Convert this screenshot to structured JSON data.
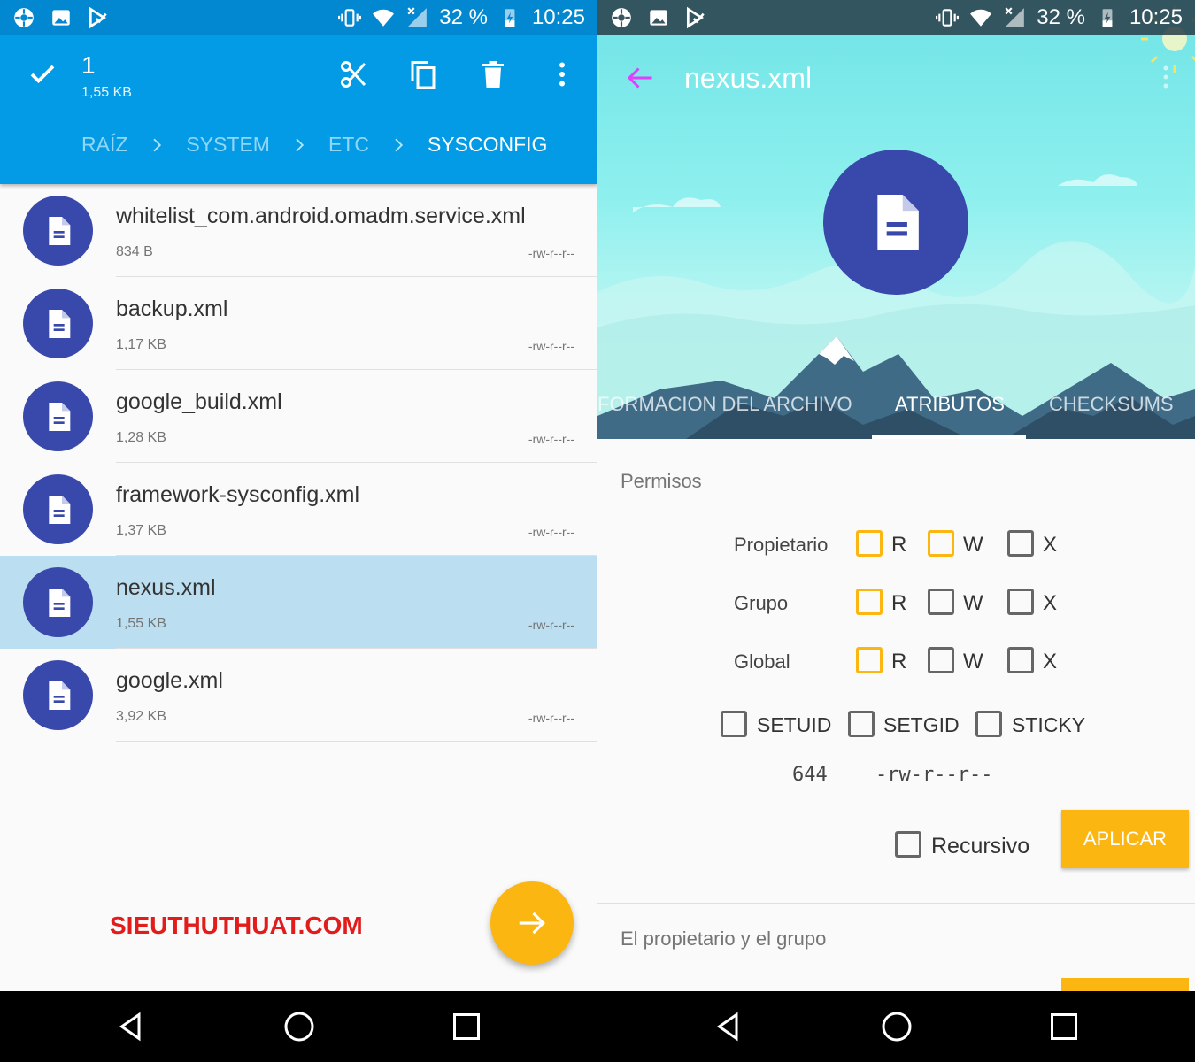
{
  "status": {
    "battery": "32 %",
    "time": "10:25"
  },
  "left": {
    "selection": {
      "count": "1",
      "size": "1,55 KB"
    },
    "breadcrumb": [
      "RAÍZ",
      "SYSTEM",
      "ETC",
      "SYSCONFIG"
    ],
    "files": [
      {
        "name": "whitelist_com.android.omadm.service.xml",
        "size": "834 B",
        "perm": "-rw-r--r--",
        "selected": false
      },
      {
        "name": "backup.xml",
        "size": "1,17 KB",
        "perm": "-rw-r--r--",
        "selected": false
      },
      {
        "name": "google_build.xml",
        "size": "1,28 KB",
        "perm": "-rw-r--r--",
        "selected": false
      },
      {
        "name": "framework-sysconfig.xml",
        "size": "1,37 KB",
        "perm": "-rw-r--r--",
        "selected": false
      },
      {
        "name": "nexus.xml",
        "size": "1,55 KB",
        "perm": "-rw-r--r--",
        "selected": true
      },
      {
        "name": "google.xml",
        "size": "3,92 KB",
        "perm": "-rw-r--r--",
        "selected": false
      }
    ],
    "watermark": "SIEUTHUTHUAT.COM"
  },
  "right": {
    "title": "nexus.xml",
    "tabs": [
      "FORMACION DEL ARCHIVO",
      "ATRIBUTOS",
      "CHECKSUMS"
    ],
    "active_tab": "ATRIBUTOS",
    "permisos_title": "Permisos",
    "rows": [
      {
        "label": "Propietario",
        "r": true,
        "w": true,
        "x": false
      },
      {
        "label": "Grupo",
        "r": true,
        "w": false,
        "x": false
      },
      {
        "label": "Global",
        "r": true,
        "w": false,
        "x": false
      }
    ],
    "letters": {
      "r": "R",
      "w": "W",
      "x": "X"
    },
    "special": {
      "setuid": "SETUID",
      "setgid": "SETGID",
      "sticky": "STICKY"
    },
    "octal": "644",
    "symbolic": "-rw-r--r--",
    "recursive_label": "Recursivo",
    "apply_label": "APLICAR",
    "owner_group_title": "El propietario y el grupo"
  },
  "colors": {
    "toolbar": "#039be5",
    "accent": "#fbb612",
    "file_icon": "#3949ab",
    "selected_row": "#bbdef0"
  }
}
